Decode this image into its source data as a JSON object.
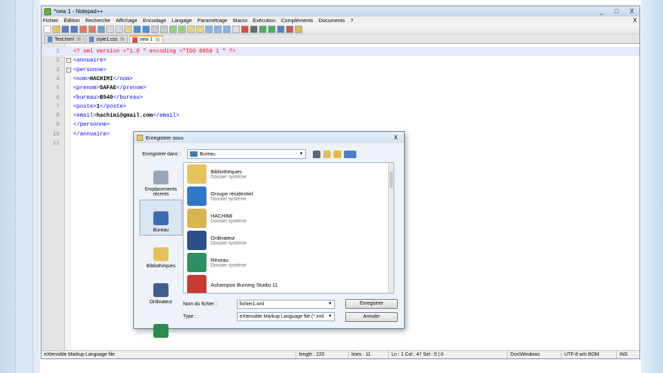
{
  "window": {
    "title": "*new  1 - Notepad++",
    "controls": [
      "_",
      "□",
      "X"
    ]
  },
  "menu": [
    "Fichier",
    "Édition",
    "Recherche",
    "Affichage",
    "Encodage",
    "Langage",
    "Paramétrage",
    "Macro",
    "Exécution",
    "Compléments",
    "Documents",
    "?"
  ],
  "menu_close": "X",
  "tabs": [
    {
      "label": "Test.html",
      "active": false
    },
    {
      "label": "style1.css",
      "active": false
    },
    {
      "label": "new  1",
      "active": true
    }
  ],
  "editor": {
    "line_numbers": [
      "1",
      "2",
      "3",
      "4",
      "5",
      "6",
      "7",
      "8",
      "9",
      "10",
      "11"
    ],
    "lines": [
      {
        "parts": [
          [
            "pi",
            "<? xml version =\"1.0 \" encoding =\"ISO 8859 1 \" ?>"
          ]
        ]
      },
      {
        "parts": [
          [
            "tag",
            "<annuaire>"
          ]
        ]
      },
      {
        "parts": [
          [
            "tag",
            "<personne>"
          ]
        ]
      },
      {
        "parts": [
          [
            "tag",
            "<nom>"
          ],
          [
            "txt",
            "HACHIMI"
          ],
          [
            "tag",
            "</nom>"
          ]
        ]
      },
      {
        "parts": [
          [
            "tag",
            "<prenom>"
          ],
          [
            "txt",
            "SAFAE"
          ],
          [
            "tag",
            "</prenom>"
          ]
        ]
      },
      {
        "parts": [
          [
            "tag",
            "<bureau>"
          ],
          [
            "txt",
            "B540"
          ],
          [
            "tag",
            "</bureau>"
          ]
        ]
      },
      {
        "parts": [
          [
            "tag",
            "<poste>"
          ],
          [
            "txt",
            "1"
          ],
          [
            "tag",
            "</poste>"
          ]
        ]
      },
      {
        "parts": [
          [
            "tag",
            "<email>"
          ],
          [
            "txt",
            "hachimi@gmail.com"
          ],
          [
            "tag",
            "</email>"
          ]
        ]
      },
      {
        "parts": [
          [
            "tag",
            "</personne>"
          ]
        ]
      },
      {
        "parts": [
          [
            "tag",
            "</annuaire>"
          ]
        ]
      },
      {
        "parts": []
      }
    ]
  },
  "status": {
    "lang": "eXtensible Markup Language file",
    "length": "length : 220",
    "lines": "lines : 11",
    "pos": "Ln : 1    Col : 47    Sel : 0 | 0",
    "eol": "Dos\\Windows",
    "enc": "UTF-8 w/o BOM",
    "mode": "INS"
  },
  "dialog": {
    "title": "Enregistrer sous",
    "close": "X",
    "lookin_label": "Enregistrer dans :",
    "lookin_value": "Bureau",
    "places": [
      {
        "label": "Emplacements récents",
        "selected": false,
        "color": "#9aa7b6"
      },
      {
        "label": "Bureau",
        "selected": true,
        "color": "#3b6db3"
      },
      {
        "label": "Bibliothèques",
        "selected": false,
        "color": "#e2c25a"
      },
      {
        "label": "Ordinateur",
        "selected": false,
        "color": "#3d5f8c"
      },
      {
        "label": "",
        "selected": false,
        "color": "#2d8a4e"
      }
    ],
    "files": [
      {
        "name": "Bibliothèques",
        "type": "Dossier système",
        "color": "#e6c35c"
      },
      {
        "name": "Groupe résidentiel",
        "type": "Dossier système",
        "color": "#2e78c8"
      },
      {
        "name": "HACHIMI",
        "type": "Dossier système",
        "color": "#d9b54f"
      },
      {
        "name": "Ordinateur",
        "type": "Dossier système",
        "color": "#2b4f86"
      },
      {
        "name": "Réseau",
        "type": "Dossier système",
        "color": "#2f8f62"
      },
      {
        "name": "Ashampoo Burning Studio 11",
        "type": "",
        "color": "#c73a2f"
      }
    ],
    "filename_label": "Nom du fichier :",
    "filename_value": "fichier1.xml",
    "type_label": "Type :",
    "type_value": "eXtensible Markup Language file (*.xml",
    "save_button": "Enregistrer",
    "cancel_button": "Annuler"
  }
}
